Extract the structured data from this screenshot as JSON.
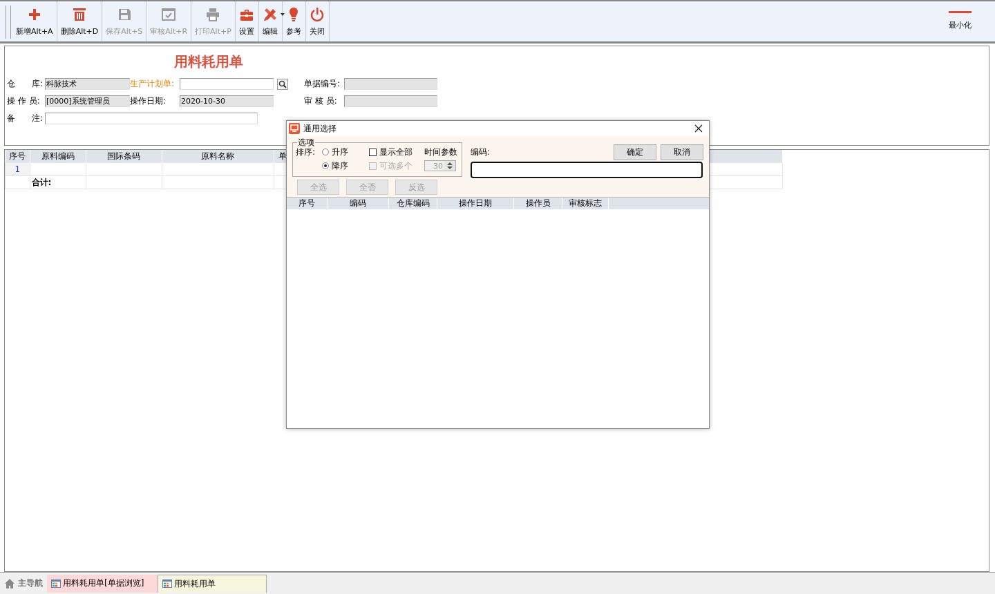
{
  "toolbar": {
    "buttons": [
      {
        "label": "新增Alt+A",
        "kind": "add",
        "disabled": false
      },
      {
        "label": "删除Alt+D",
        "kind": "delete",
        "disabled": false
      },
      {
        "label": "保存Alt+S",
        "kind": "save",
        "disabled": true
      },
      {
        "label": "审核Alt+R",
        "kind": "audit",
        "disabled": true
      },
      {
        "label": "打印Alt+P",
        "kind": "print",
        "disabled": true
      },
      {
        "label": "设置",
        "kind": "settings",
        "disabled": false
      },
      {
        "label": "编辑",
        "kind": "edit",
        "disabled": false
      },
      {
        "label": "参考",
        "kind": "reference",
        "disabled": false
      },
      {
        "label": "关闭",
        "kind": "close",
        "disabled": false
      }
    ],
    "minimize": {
      "label": "最小化"
    }
  },
  "form": {
    "title": "用料耗用单",
    "rows": [
      [
        {
          "label": "仓　　库:",
          "value": "科脉技术",
          "kind": "readonly"
        },
        {
          "label": "生产计划单:",
          "kind": "lookup"
        },
        {
          "label": "单据编号:",
          "kind": "readonly"
        }
      ],
      [
        {
          "label": "操 作 员:",
          "value": "[0000]系统管理员",
          "kind": "readonly"
        },
        {
          "label": "操作日期:",
          "value": "2020-10-30",
          "kind": "readonly"
        },
        {
          "label": "审 核 员:",
          "kind": "readonly"
        }
      ],
      [
        {
          "label": "备　　注:",
          "kind": "long"
        }
      ]
    ]
  },
  "grid": {
    "columns": [
      "序号",
      "原料编码",
      "国际条码",
      "原料名称",
      "单"
    ],
    "rows": [
      {
        "kind": "item",
        "cells": [
          "1",
          "",
          "",
          "",
          ""
        ]
      },
      {
        "kind": "total",
        "cells": [
          "",
          "合计:",
          "",
          "",
          ""
        ]
      }
    ]
  },
  "dialog": {
    "title": "通用选择",
    "options": {
      "legend": "选项",
      "sort_label": "排序:",
      "radios": [
        {
          "label": "升序",
          "selected": false
        },
        {
          "label": "降序",
          "selected": true
        }
      ],
      "checkboxes": [
        {
          "label": "显示全部",
          "checked": false,
          "disabled": false
        },
        {
          "label": "可选多个",
          "checked": false,
          "disabled": true
        }
      ],
      "time_label": "时间参数",
      "spinner": {
        "value": "30",
        "disabled": true
      }
    },
    "code_label": "编码:",
    "code_field": {
      "focused": true
    },
    "buttons": [
      "确定",
      "取消"
    ],
    "select_buttons": [
      {
        "label": "全选",
        "disabled": true
      },
      {
        "label": "全否",
        "disabled": true
      },
      {
        "label": "反选",
        "disabled": true
      }
    ],
    "columns": [
      "序号",
      "编码",
      "仓库编码",
      "操作日期",
      "操作员",
      "审核标志"
    ]
  },
  "status_bar": {
    "home": "主导航",
    "tabs": [
      {
        "label": "用料耗用单[单据浏览]",
        "selected": false,
        "color": "#ffd9d9"
      },
      {
        "label": "用料耗用单",
        "selected": true,
        "color": "#f7f5dc"
      }
    ]
  }
}
